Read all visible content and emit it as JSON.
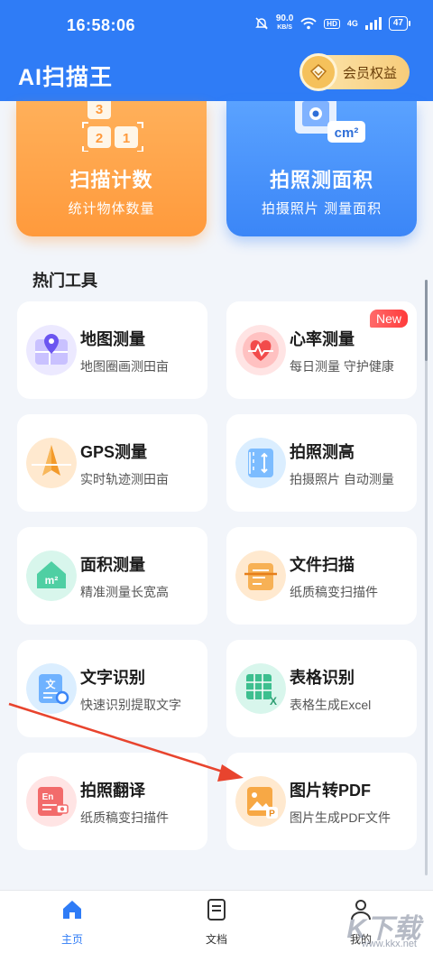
{
  "status_bar": {
    "time": "16:58:06",
    "net_speed": "90.0",
    "net_unit": "KB/S",
    "hd": "HD",
    "network": "4G",
    "battery": "47"
  },
  "header": {
    "title": "AI扫描王",
    "vip_label": "会员权益"
  },
  "feature_cards": [
    {
      "title": "扫描计数",
      "subtitle": "统计物体数量",
      "icon": "count-blocks-icon",
      "digits": [
        "3",
        "2",
        "1"
      ]
    },
    {
      "title": "拍照测面积",
      "subtitle": "拍摄照片 测量面积",
      "icon": "area-measure-icon",
      "unit": "cm²"
    }
  ],
  "section": {
    "title": "热门工具"
  },
  "tools": [
    {
      "name": "地图测量",
      "desc": "地图圈画测田亩",
      "icon": "map-pin-icon"
    },
    {
      "name": "心率测量",
      "desc": "每日测量 守护健康",
      "icon": "heart-rate-icon",
      "badge": "New"
    },
    {
      "name": "GPS测量",
      "desc": "实时轨迹测田亩",
      "icon": "gps-compass-icon"
    },
    {
      "name": "拍照测高",
      "desc": "拍摄照片 自动测量",
      "icon": "height-measure-icon"
    },
    {
      "name": "面积测量",
      "desc": "精准测量长宽高",
      "icon": "area-house-icon",
      "icon_text": "m²"
    },
    {
      "name": "文件扫描",
      "desc": "纸质稿变扫描件",
      "icon": "document-scan-icon"
    },
    {
      "name": "文字识别",
      "desc": "快速识别提取文字",
      "icon": "text-recognition-icon",
      "icon_text": "文"
    },
    {
      "name": "表格识别",
      "desc": "表格生成Excel",
      "icon": "table-excel-icon",
      "icon_text": "X"
    },
    {
      "name": "拍照翻译",
      "desc": "纸质稿变扫描件",
      "icon": "photo-translate-icon",
      "icon_text": "En"
    },
    {
      "name": "图片转PDF",
      "desc": "图片生成PDF文件",
      "icon": "image-to-pdf-icon",
      "icon_text": "P"
    }
  ],
  "bottom_nav": [
    {
      "label": "主页",
      "icon": "home-icon",
      "active": true
    },
    {
      "label": "文档",
      "icon": "document-icon",
      "active": false
    },
    {
      "label": "我的",
      "icon": "user-icon",
      "active": false
    }
  ],
  "watermark": {
    "text": "K下载",
    "url": "www.kkx.net"
  },
  "colors": {
    "primary": "#2f7cf6",
    "orange_card": "#ff9a3c",
    "blue_card": "#3b86f7",
    "badge_red": "#ff3b3b",
    "annotation_arrow": "#e8442e"
  }
}
